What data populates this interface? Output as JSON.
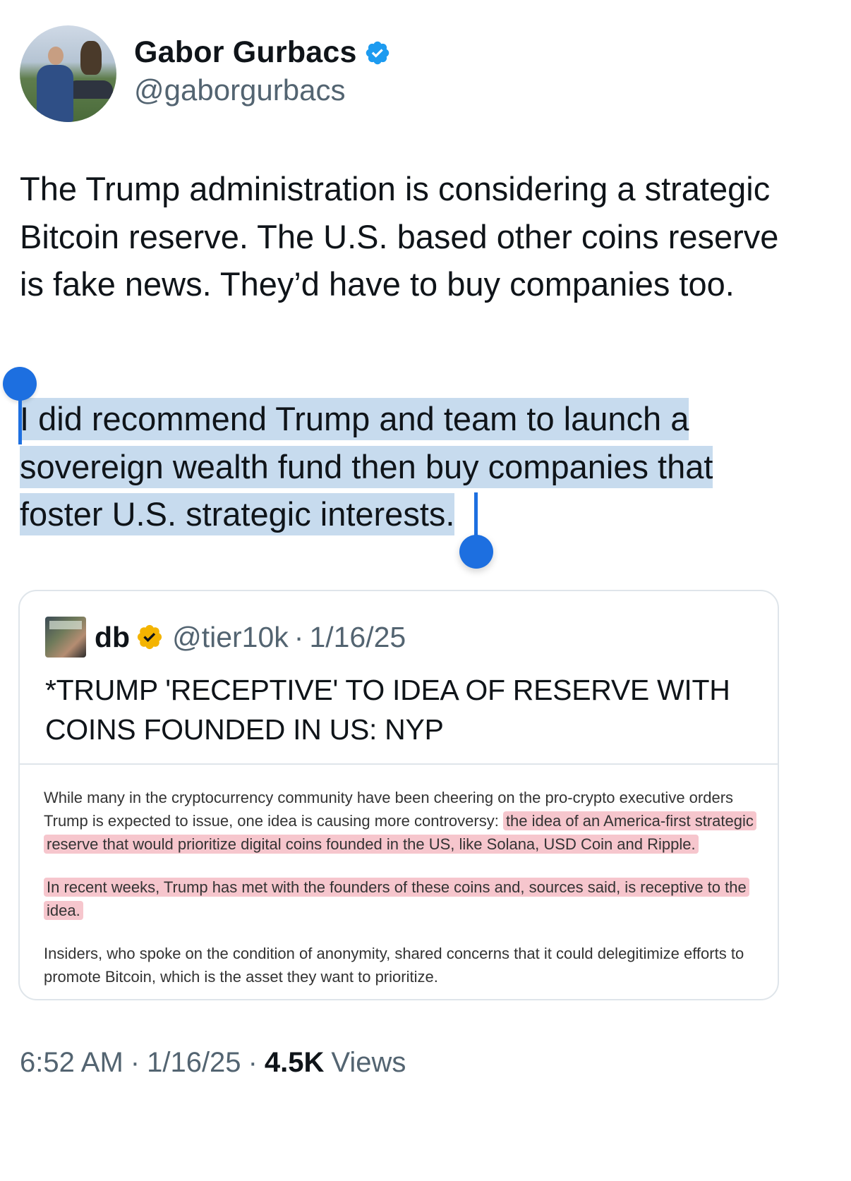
{
  "author": {
    "display_name": "Gabor Gurbacs",
    "handle": "@gaborgurbacs",
    "verified_color": "#1d9bf0"
  },
  "tweet": {
    "paragraph_1": "The Trump administration is considering a strategic Bitcoin reserve. The U.S. based other coins reserve is fake news. They’d have to buy companies too.",
    "paragraph_2": "I did recommend Trump and team to launch a sovereign wealth fund then buy companies that foster U.S. strategic interests.",
    "selection_color": "#c7dbee",
    "selection_handle_color": "#1d6fe0"
  },
  "quote": {
    "display_name": "db",
    "handle": "@tier10k",
    "date": "1/16/25",
    "verified_color": "#f4b400",
    "text": "*TRUMP 'RECEPTIVE' TO IDEA OF RESERVE WITH COINS FOUNDED IN US: NYP",
    "article": {
      "p1_plain": "While many in the cryptocurrency community have been cheering on the pro-crypto executive orders Trump is expected to issue, one idea is causing more controversy: ",
      "p1_highlight": "the idea of an America-first strategic reserve that would prioritize digital coins founded in the US, like Solana, USD Coin and Ripple.",
      "p2_highlight": "In recent weeks, Trump has met with the founders of these coins and, sources said, is receptive to the idea.",
      "p3_plain": "Insiders, who spoke on the condition of anonymity, shared concerns that it could delegitimize efforts to promote Bitcoin, which is the asset they want to prioritize.",
      "highlight_color": "#f6c6cd"
    }
  },
  "footer": {
    "time": "6:52 AM",
    "date": "1/16/25",
    "views_count": "4.5K",
    "views_label": "Views",
    "separator": "·"
  }
}
